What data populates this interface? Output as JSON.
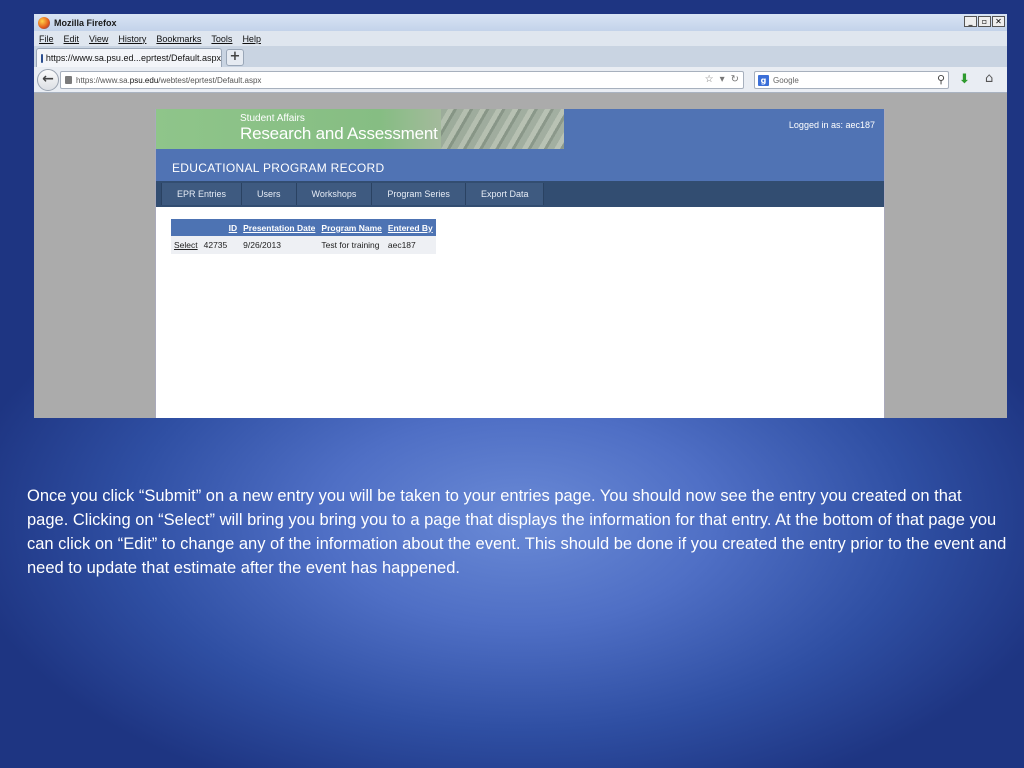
{
  "window": {
    "title": "Mozilla Firefox",
    "buttons": [
      "_",
      "▫",
      "✕"
    ]
  },
  "menu": [
    "File",
    "Edit",
    "View",
    "History",
    "Bookmarks",
    "Tools",
    "Help"
  ],
  "tab": {
    "label": "https://www.sa.psu.ed...eprtest/Default.aspx",
    "new_tab": "+"
  },
  "address": {
    "url_prefix": "https://www.sa.",
    "url_domain": "psu.edu",
    "url_path": "/webtest/eprtest/Default.aspx"
  },
  "search": {
    "placeholder": "Google"
  },
  "site": {
    "banner_small": "Student Affairs",
    "banner_big": "Research and Assessment",
    "logged_in": "Logged in as: aec187",
    "title": "EDUCATIONAL PROGRAM RECORD",
    "nav": [
      "EPR Entries",
      "Users",
      "Workshops",
      "Program Series",
      "Export Data"
    ]
  },
  "table": {
    "headers": [
      "",
      "ID",
      "Presentation Date",
      "Program Name",
      "Entered By"
    ],
    "rows": [
      [
        "Select",
        "42735",
        "9/26/2013",
        "Test for training",
        "aec187"
      ]
    ]
  },
  "caption": "Once you click “Submit” on a new entry you will be taken to your entries page. You should now see the entry you created on that page.  Clicking on “Select” will bring you bring you to a page that displays the information for that entry. At the bottom of that page you can click on “Edit” to change any of the information about the event. This should be done if you created the entry prior to the event and need to update that estimate after the event has happened.",
  "colors": {
    "slide_bg": "#2f4fa3",
    "site_header": "#5073b4",
    "site_nav": "#324d71",
    "banner_green": "#8fc58a"
  }
}
